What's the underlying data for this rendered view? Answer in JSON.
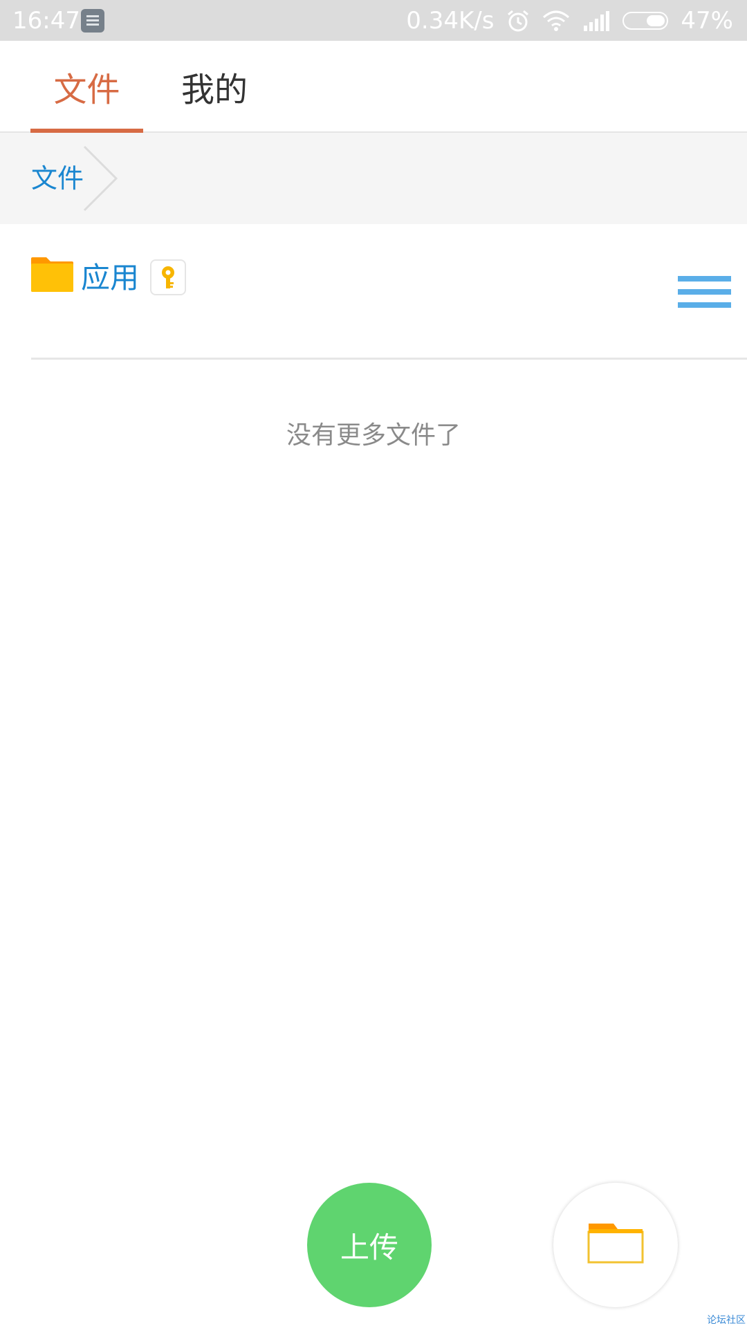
{
  "status_bar": {
    "time": "16:47",
    "net_speed": "0.34K/s",
    "battery_percent": "47%",
    "battery_level": 0.47,
    "icons": [
      "notification-app-icon",
      "alarm-icon",
      "wifi-icon",
      "signal-icon",
      "battery-icon"
    ]
  },
  "tabs": [
    {
      "label": "文件",
      "active": true
    },
    {
      "label": "我的",
      "active": false
    }
  ],
  "breadcrumb": {
    "items": [
      {
        "label": "文件"
      }
    ]
  },
  "files": [
    {
      "name": "应用",
      "type": "folder",
      "badge_icon": "key-icon"
    }
  ],
  "empty_message": "没有更多文件了",
  "fab": {
    "upload_label": "上传",
    "folder_icon": "folder-icon"
  },
  "watermark": "论坛社区",
  "colors": {
    "accent": "#d76b44",
    "link_blue": "#1a86d0",
    "menu_blue": "#5aaee8",
    "folder_yellow": "#ffc107",
    "folder_orange": "#ff9800",
    "upload_green": "#5fd46f"
  }
}
